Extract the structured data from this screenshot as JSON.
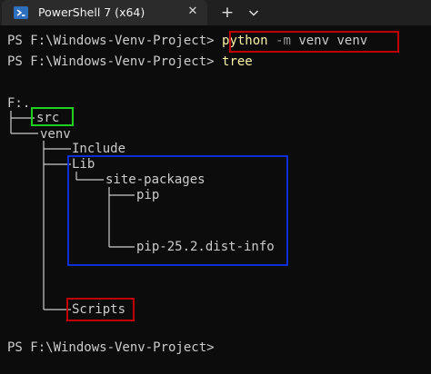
{
  "window": {
    "tab_title": "PowerShell 7 (x64)",
    "tab_icon": "powershell-icon",
    "close_glyph": "✕",
    "new_tab_glyph": "+",
    "dropdown_icon": "chevron-down-icon"
  },
  "terminal": {
    "prompt": "PS F:\\Windows-Venv-Project> ",
    "command1": {
      "name": "python",
      "param": " -m",
      "args": " venv venv"
    },
    "command2": {
      "name": "tree"
    },
    "tree": {
      "root": "F:.",
      "src": "src",
      "venv": "venv",
      "include": "Include",
      "lib": "Lib",
      "site_packages": "site-packages",
      "pip": "pip",
      "pip_dist_info": "pip-25.2.dist-info",
      "scripts": "Scripts"
    },
    "final_prompt": "PS F:\\Windows-Venv-Project>"
  },
  "colors": {
    "background": "#0c0c0c",
    "text": "#cccccc",
    "command": "#f9f1a5",
    "param": "#9a9a9a",
    "highlight_red": "#c00000",
    "highlight_green": "#1fd11f",
    "highlight_blue": "#0a2fd6"
  }
}
